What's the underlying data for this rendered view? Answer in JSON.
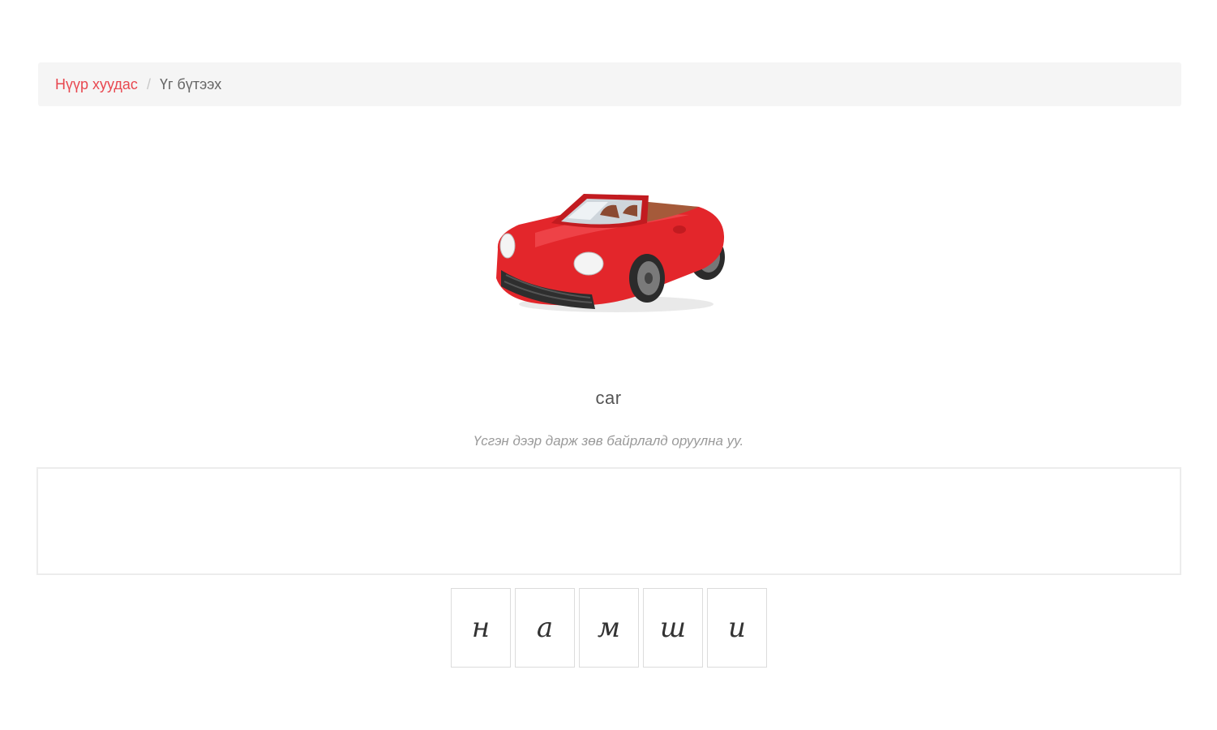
{
  "breadcrumb": {
    "home_label": "Нүүр хуудас",
    "separator": "/",
    "current_label": "Үг бүтээх"
  },
  "exercise": {
    "image_icon": "red-convertible-car-icon",
    "word": "car",
    "instruction": "Үсгэн дээр дарж зөв байрлалд оруулна уу.",
    "letters": [
      "н",
      "а",
      "м",
      "ш",
      "и"
    ]
  },
  "colors": {
    "accent": "#e8474f",
    "car_body": "#e3262b",
    "breadcrumb_bg": "#f5f5f5"
  }
}
